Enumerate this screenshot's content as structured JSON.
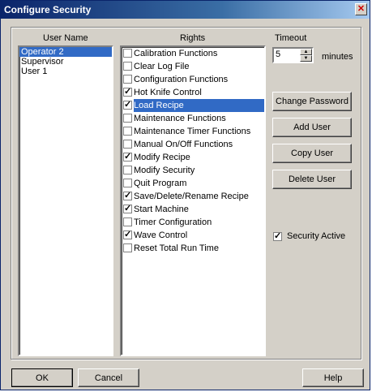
{
  "window": {
    "title": "Configure Security",
    "close_icon": "close-icon"
  },
  "users": {
    "header": "User Name",
    "items": [
      "Operator 2",
      "Supervisor",
      "User 1"
    ],
    "selected_index": 0
  },
  "rights": {
    "header": "Rights",
    "items": [
      {
        "label": "Calibration Functions",
        "checked": false
      },
      {
        "label": "Clear Log File",
        "checked": false
      },
      {
        "label": "Configuration Functions",
        "checked": false
      },
      {
        "label": "Hot Knife Control",
        "checked": true
      },
      {
        "label": "Load Recipe",
        "checked": true,
        "selected": true
      },
      {
        "label": "Maintenance Functions",
        "checked": false
      },
      {
        "label": "Maintenance Timer Functions",
        "checked": false
      },
      {
        "label": "Manual On/Off Functions",
        "checked": false
      },
      {
        "label": "Modify Recipe",
        "checked": true
      },
      {
        "label": "Modify Security",
        "checked": false
      },
      {
        "label": "Quit Program",
        "checked": false
      },
      {
        "label": "Save/Delete/Rename Recipe",
        "checked": true
      },
      {
        "label": "Start Machine",
        "checked": true
      },
      {
        "label": "Timer Configuration",
        "checked": false
      },
      {
        "label": "Wave Control",
        "checked": true
      },
      {
        "label": "Reset Total Run Time",
        "checked": false
      }
    ]
  },
  "timeout": {
    "label": "Timeout",
    "value": "5",
    "unit": "minutes"
  },
  "buttons": {
    "change_password": "Change Password",
    "add_user": "Add User",
    "copy_user": "Copy User",
    "delete_user": "Delete User",
    "ok": "OK",
    "cancel": "Cancel",
    "help": "Help"
  },
  "security_active": {
    "label": "Security Active",
    "checked": true
  }
}
